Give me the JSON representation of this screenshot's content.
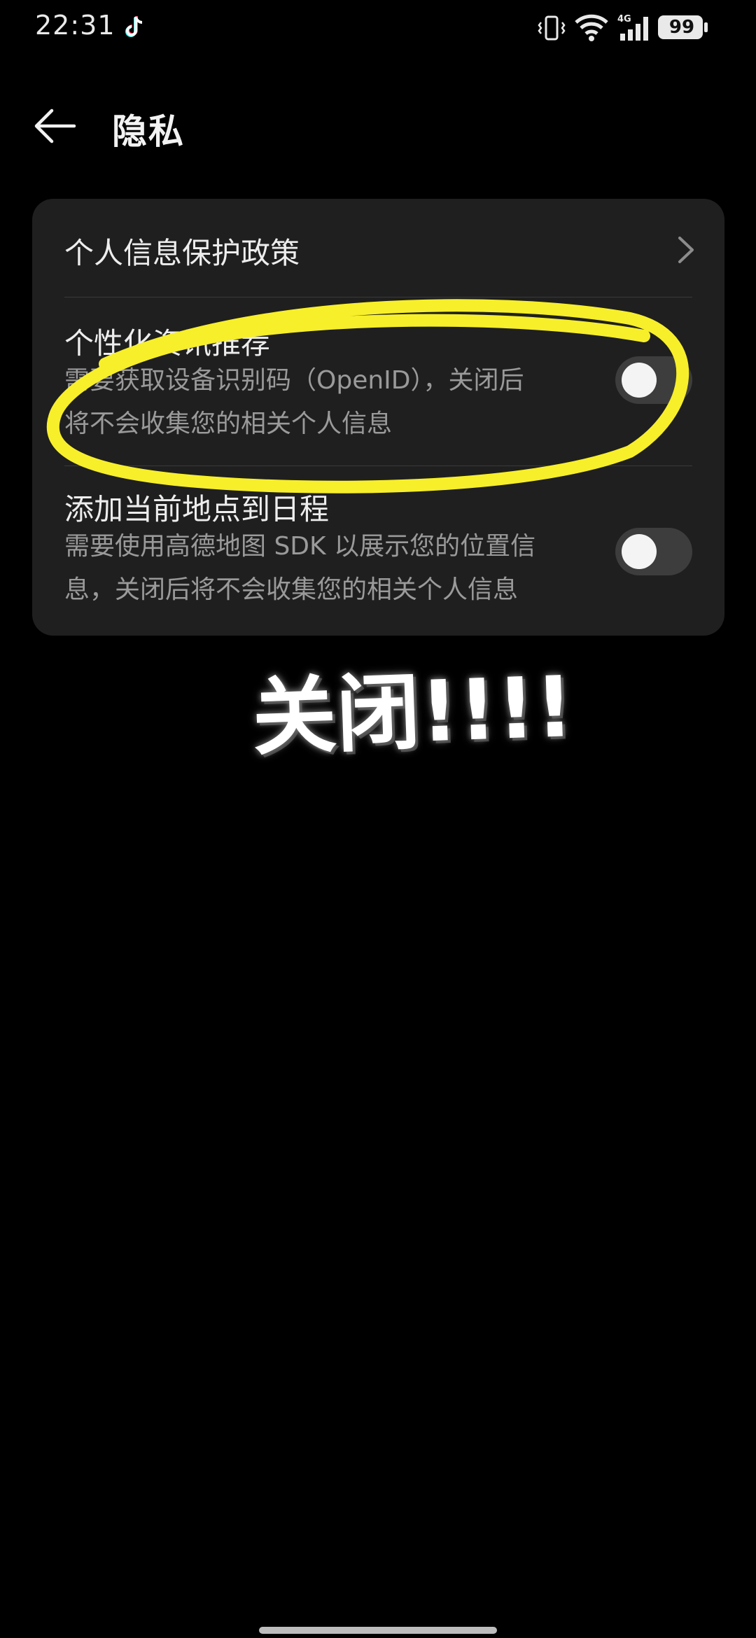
{
  "status_bar": {
    "time": "22:31",
    "battery": "99",
    "icons": [
      "tiktok-icon",
      "vibrate-icon",
      "wifi-icon",
      "signal-4g-icon",
      "battery-icon"
    ]
  },
  "header": {
    "title": "隐私",
    "back_icon": "arrow-left-icon"
  },
  "settings": {
    "items": [
      {
        "title": "个人信息保护政策",
        "icon": "chevron-right-icon"
      },
      {
        "title": "个性化资讯推荐",
        "desc_line1": "需要获取设备识别码（OpenID），关闭后",
        "desc_line2": "将不会收集您的相关个人信息",
        "toggle_on": false
      },
      {
        "title": "添加当前地点到日程",
        "desc_line1": "需要使用高德地图 SDK 以展示您的位置信",
        "desc_line2": "息，关闭后将不会收集您的相关个人信息",
        "toggle_on": false
      }
    ]
  },
  "annotation": {
    "caption": "关闭!!!!",
    "highlight_color": "#f7ef2a"
  },
  "colors": {
    "background": "#000000",
    "card": "#1f1f1f",
    "toggle_off": "#3d3d3d"
  }
}
